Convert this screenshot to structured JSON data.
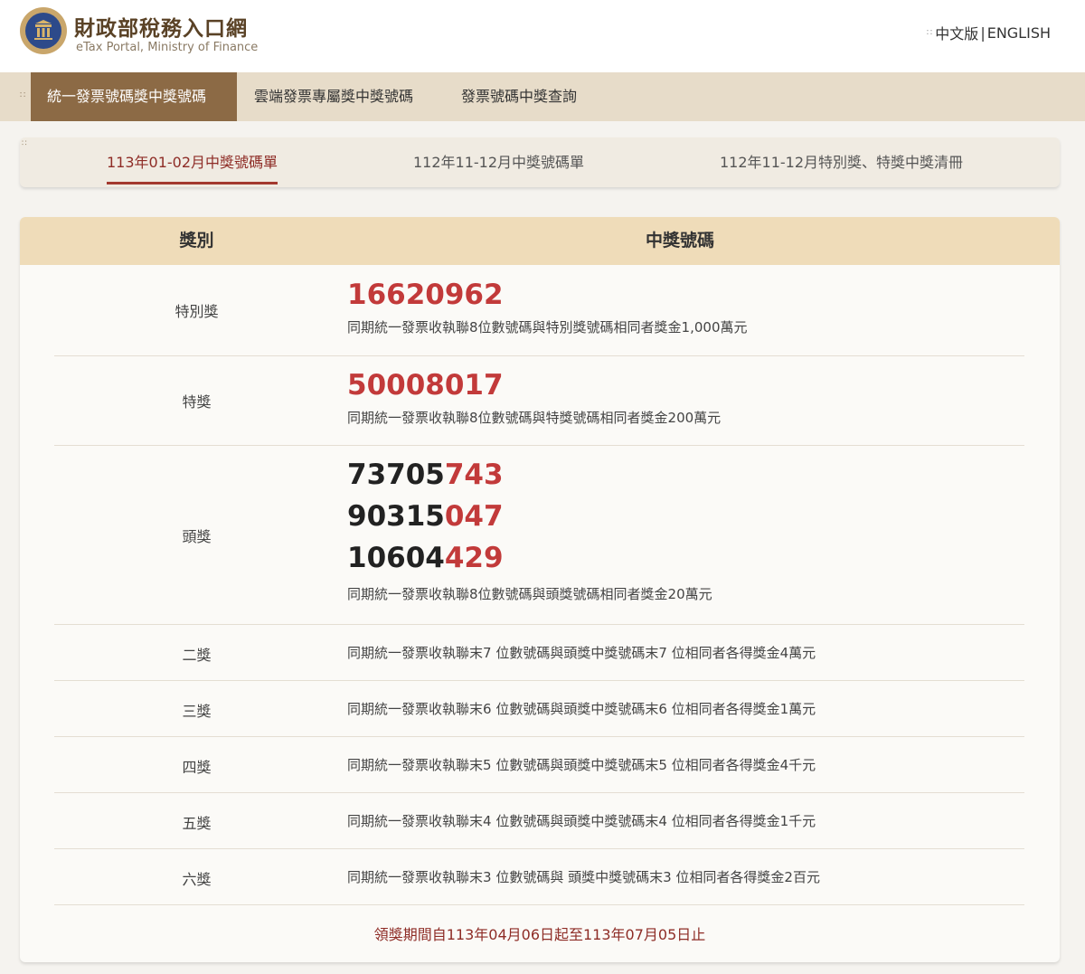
{
  "header": {
    "title": "財政部稅務入口網",
    "subtitle": "eTax Portal, Ministry of Finance",
    "lang_zh": "中文版",
    "lang_sep": "|",
    "lang_en": "ENGLISH"
  },
  "main_nav": [
    {
      "label": "統一發票號碼獎中獎號碼",
      "active": true
    },
    {
      "label": "雲端發票專屬獎中獎號碼",
      "active": false
    },
    {
      "label": "發票號碼中獎查詢",
      "active": false
    }
  ],
  "subtabs": [
    {
      "label": "113年01-02月中獎號碼單",
      "active": true
    },
    {
      "label": "112年11-12月中獎號碼單",
      "active": false
    },
    {
      "label": "112年11-12月特別獎、特獎中獎清冊",
      "active": false
    }
  ],
  "table": {
    "col_prize": "獎別",
    "col_numbers": "中獎號碼",
    "special": {
      "name": "特別獎",
      "number": "16620962",
      "note": "同期統一發票收執聯8位數號碼與特別獎號碼相同者獎金1,000萬元"
    },
    "grand": {
      "name": "特獎",
      "number": "50008017",
      "note": "同期統一發票收執聯8位數號碼與特獎號碼相同者獎金200萬元"
    },
    "first": {
      "name": "頭獎",
      "numbers": [
        {
          "prefix": "73705",
          "suffix": "743"
        },
        {
          "prefix": "90315",
          "suffix": "047"
        },
        {
          "prefix": "10604",
          "suffix": "429"
        }
      ],
      "note": "同期統一發票收執聯8位數號碼與頭獎號碼相同者獎金20萬元"
    },
    "second": {
      "name": "二獎",
      "note": "同期統一發票收執聯末7 位數號碼與頭獎中獎號碼末7 位相同者各得獎金4萬元"
    },
    "third": {
      "name": "三獎",
      "note": "同期統一發票收執聯末6 位數號碼與頭獎中獎號碼末6 位相同者各得獎金1萬元"
    },
    "fourth": {
      "name": "四獎",
      "note": "同期統一發票收執聯末5 位數號碼與頭獎中獎號碼末5 位相同者各得獎金4千元"
    },
    "fifth": {
      "name": "五獎",
      "note": "同期統一發票收執聯末4 位數號碼與頭獎中獎號碼末4 位相同者各得獎金1千元"
    },
    "sixth": {
      "name": "六獎",
      "note": "同期統一發票收執聯末3 位數號碼與 頭獎中獎號碼末3 位相同者各得獎金2百元"
    },
    "claim_period": "領獎期間自113年04月06日起至113年07月05日止"
  },
  "colors": {
    "accent_red": "#c23a3a",
    "nav_active": "#8c6a45",
    "table_header": "#efdcb9"
  }
}
